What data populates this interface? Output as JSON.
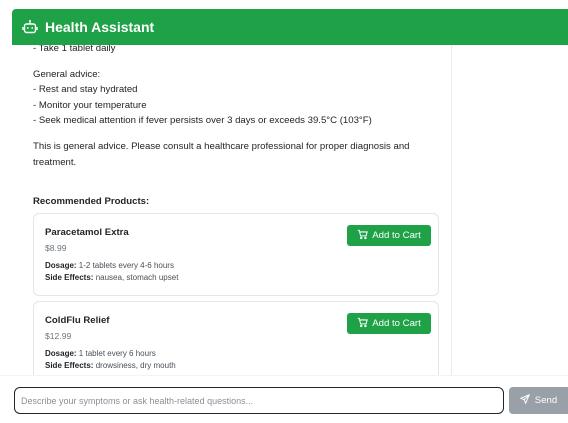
{
  "header": {
    "title": "Health Assistant",
    "icon": "robot-icon"
  },
  "message": {
    "lines_top": [
      "- Take 1 tablet daily"
    ],
    "advice_heading": "General advice:",
    "advice": [
      "- Rest and stay hydrated",
      "- Monitor your temperature",
      "- Seek medical attention if fever persists over 3 days or exceeds 39.5°C (103°F)"
    ],
    "disclaimer": "This is general advice. Please consult a healthcare professional for proper diagnosis and treatment."
  },
  "recommended": {
    "title": "Recommended Products:",
    "dosage_label": "Dosage:",
    "side_effects_label": "Side Effects:",
    "add_to_cart_label": "Add to Cart",
    "products": [
      {
        "name": "Paracetamol Extra",
        "price": "$8.99",
        "dosage": "1-2 tablets every 4-6 hours",
        "side_effects": "nausea, stomach upset"
      },
      {
        "name": "ColdFlu Relief",
        "price": "$12.99",
        "dosage": "1 tablet every 6 hours",
        "side_effects": "drowsiness, dry mouth"
      }
    ]
  },
  "composer": {
    "placeholder": "Describe your symptoms or ask health-related questions...",
    "send_label": "Send"
  },
  "colors": {
    "accent": "#1fa148",
    "send_disabled": "#99a0a7"
  }
}
